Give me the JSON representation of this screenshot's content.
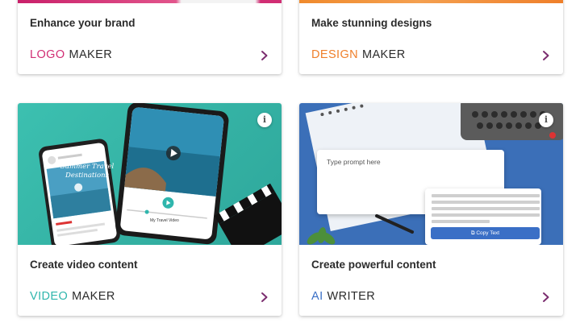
{
  "colors": {
    "logo_accent": "#d12e74",
    "design_accent": "#ef7f2a",
    "video_accent": "#2fb6ad",
    "ai_accent": "#3a6fc6",
    "chevron": "#7b2d6f"
  },
  "cards": [
    {
      "title": "Enhance your brand",
      "accent": "LOGO",
      "word": "MAKER",
      "chevron": "chevron-right-icon"
    },
    {
      "title": "Make stunning designs",
      "accent": "DESIGN",
      "word": "MAKER",
      "chevron": "chevron-right-icon"
    },
    {
      "title": "Create video content",
      "accent": "VIDEO",
      "word": "MAKER",
      "chevron": "chevron-right-icon",
      "info": "i",
      "thumb": {
        "video_title": "Summer Travel Destinations",
        "video_caption": "My Travel Video"
      }
    },
    {
      "title": "Create powerful content",
      "accent": "AI",
      "word": "WRITER",
      "chevron": "chevron-right-icon",
      "info": "i",
      "thumb": {
        "prompt_placeholder": "Type prompt here",
        "copy_label": "Copy Text"
      }
    }
  ]
}
